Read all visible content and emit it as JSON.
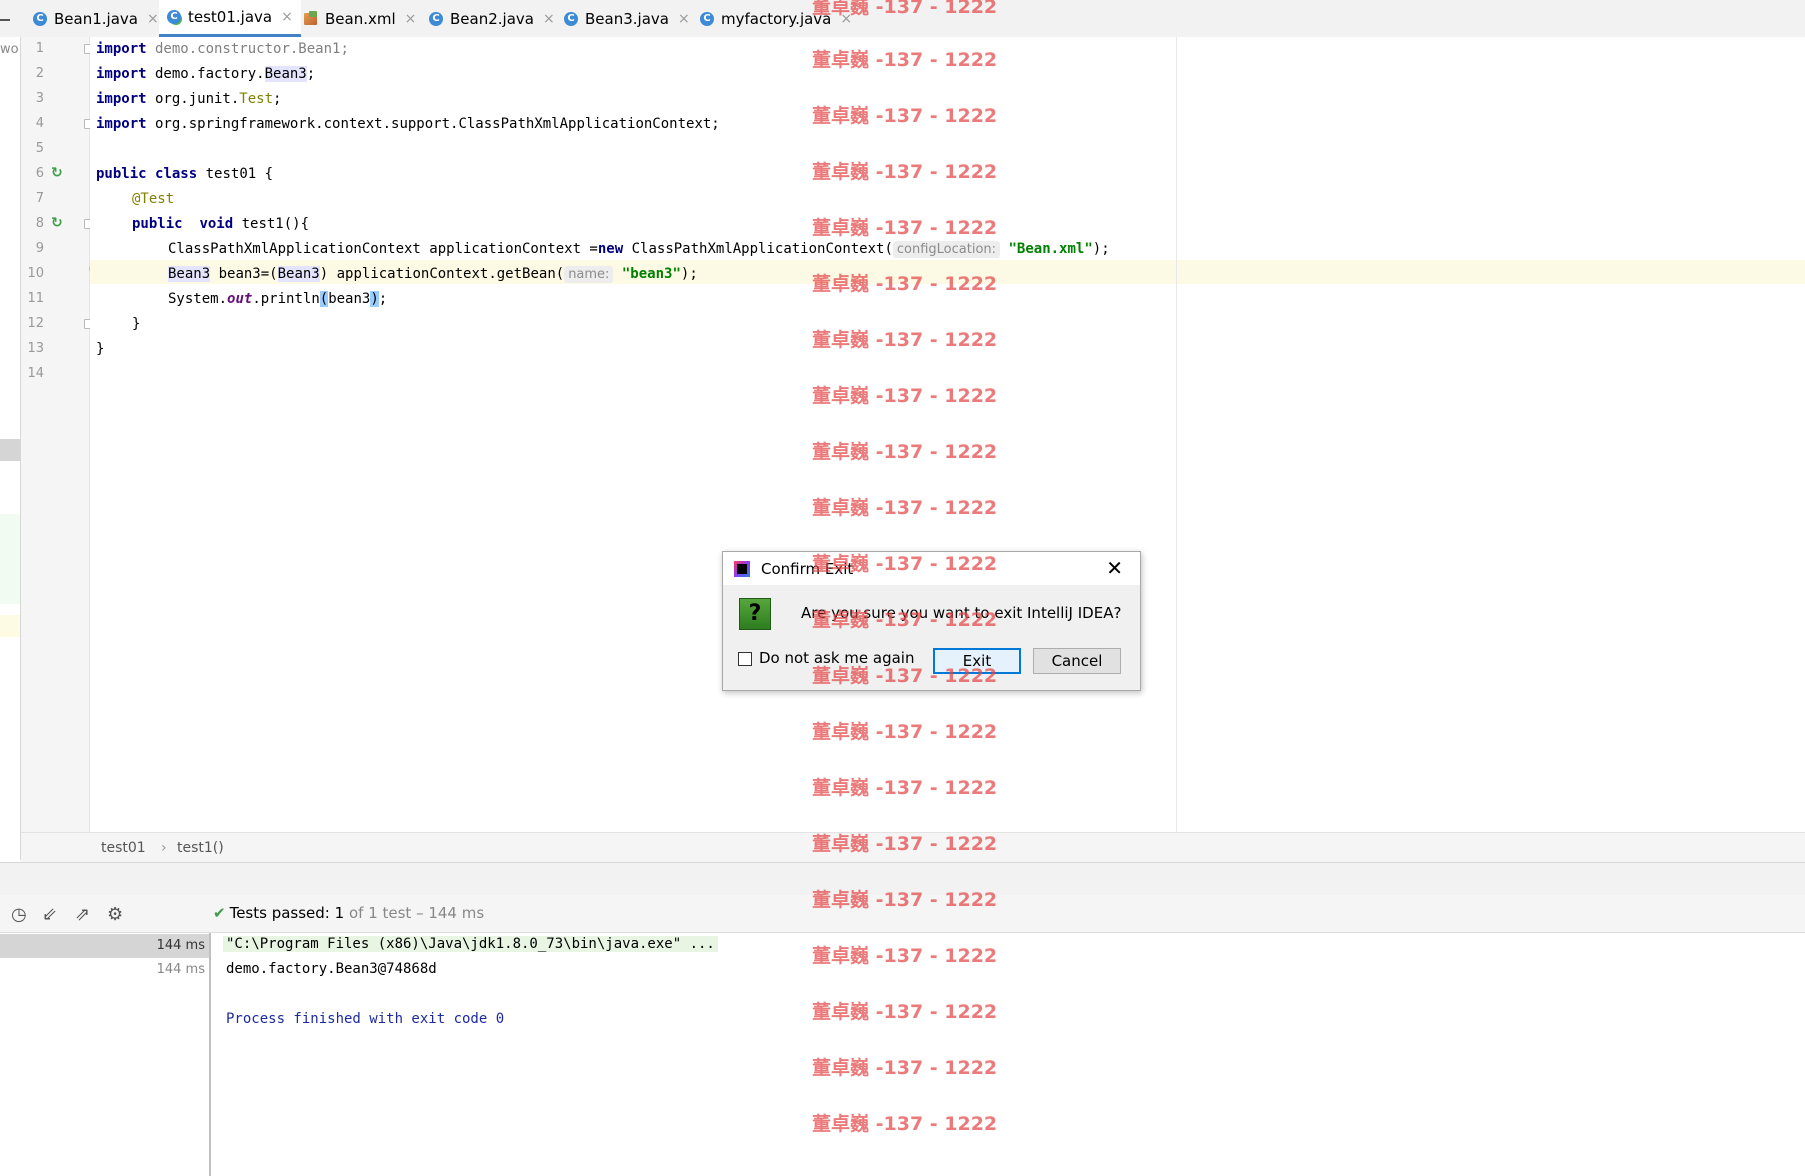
{
  "tabs": [
    {
      "label": "Bean1.java",
      "icon": "java-class-icon"
    },
    {
      "label": "test01.java",
      "icon": "java-test-class-icon",
      "active": true
    },
    {
      "label": "Bean.xml",
      "icon": "xml-file-icon"
    },
    {
      "label": "Bean2.java",
      "icon": "java-class-icon"
    },
    {
      "label": "Bean3.java",
      "icon": "java-class-icon"
    },
    {
      "label": "myfactory.java",
      "icon": "java-class-icon"
    }
  ],
  "tab_close_glyph": "×",
  "left_strip_text": "wo",
  "gutter": {
    "line_numbers": [
      "1",
      "2",
      "3",
      "4",
      "5",
      "6",
      "7",
      "8",
      "9",
      "10",
      "11",
      "12",
      "13",
      "14"
    ]
  },
  "code": {
    "l1": {
      "kw": "import",
      "rest": " demo.constructor.Bean1;"
    },
    "l2": {
      "kw": "import",
      "a": " demo.factory.",
      "b": "Bean3",
      "c": ";"
    },
    "l3": {
      "kw": "import",
      "a": " org.junit.",
      "b": "Test",
      "c": ";"
    },
    "l4": {
      "kw": "import",
      "rest": " org.springframework.context.support.ClassPathXmlApplicationContext;"
    },
    "l6": {
      "kw1": "public",
      "kw2": "class",
      "rest": " test01 {"
    },
    "l7": {
      "ann": "@Test"
    },
    "l8": {
      "kw1": "public",
      "kw2": "void",
      "rest": " test1(){"
    },
    "l9": {
      "a": "ClassPathXmlApplicationContext applicationContext =",
      "kw": "new",
      "b": " ClassPathXmlApplicationContext(",
      "hint": "configLocation:",
      "str": "\"Bean.xml\"",
      "c": ");"
    },
    "l10": {
      "a": "Bean3",
      "b": " bean3=(",
      "c": "Bean3",
      "d": ") applicationContext.getBean(",
      "hint": "name:",
      "str": "\"bean3\"",
      "e": ");"
    },
    "l11": {
      "a": "System.",
      "st": "out",
      "b": ".println",
      "p1": "(",
      "c": "bean3",
      "p2": ")",
      "d": ";"
    },
    "l12": "}",
    "l13": "}"
  },
  "breadcrumb": {
    "class_name": "test01",
    "separator": "›",
    "method_name": "test1()"
  },
  "run": {
    "status_prefix": "Tests passed:",
    "passed_count": "1",
    "status_suffix": "of 1 test – 144 ms",
    "toolbar_icons": [
      "history-icon",
      "import-tests-icon",
      "export-tests-icon",
      "settings-icon"
    ],
    "tree": [
      {
        "time": "144 ms",
        "selected": true
      },
      {
        "time": "144 ms",
        "selected": false
      }
    ],
    "console": {
      "command": "\"C:\\Program Files (x86)\\Java\\jdk1.8.0_73\\bin\\java.exe\" ...",
      "output": "demo.factory.Bean3@74868d",
      "finish": "Process finished with exit code 0"
    }
  },
  "dialog": {
    "title": "Confirm Exit",
    "message": "Are you sure you want to exit IntelliJ IDEA?",
    "question_glyph": "?",
    "checkbox_label": "Do not ask me again",
    "checkbox_checked": false,
    "exit_label": "Exit",
    "cancel_label": "Cancel",
    "close_glyph": "✕"
  },
  "watermark": {
    "text": "董卓巍 -137 - 1222",
    "color": "#e44646"
  }
}
